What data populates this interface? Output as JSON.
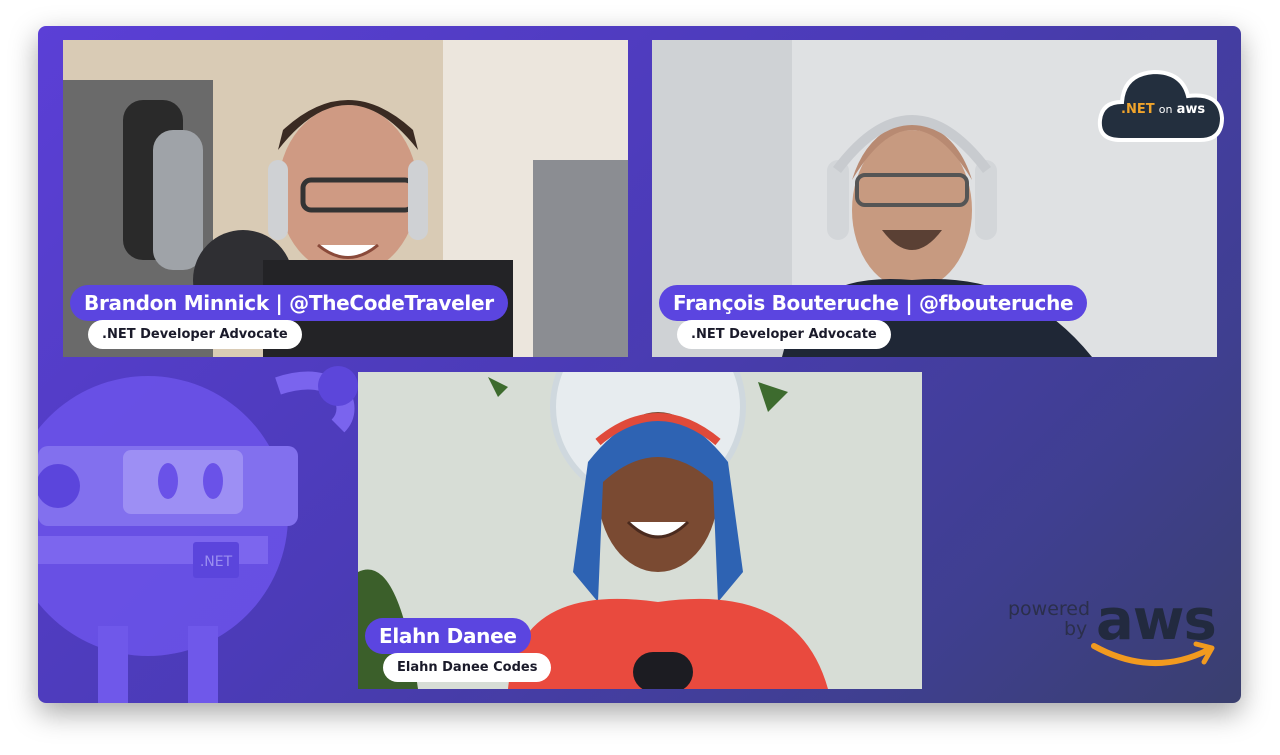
{
  "participants": [
    {
      "name": "Brandon Minnick | @TheCodeTraveler",
      "role": ".NET Developer Advocate"
    },
    {
      "name": "François Bouteruche | @fbouteruche",
      "role": ".NET Developer Advocate"
    },
    {
      "name": "Elahn Danee",
      "role": "Elahn Danee Codes"
    }
  ],
  "logo": {
    "net": ".NET",
    "on": "on",
    "aws": "aws"
  },
  "mascot": {
    "badge": ".NET"
  },
  "powered": {
    "powered": "powered",
    "by": "by",
    "aws": "aws"
  },
  "colors": {
    "background": "#4b3bb7",
    "name_pill": "#5b45e0",
    "aws_smile": "#f29a1f"
  }
}
